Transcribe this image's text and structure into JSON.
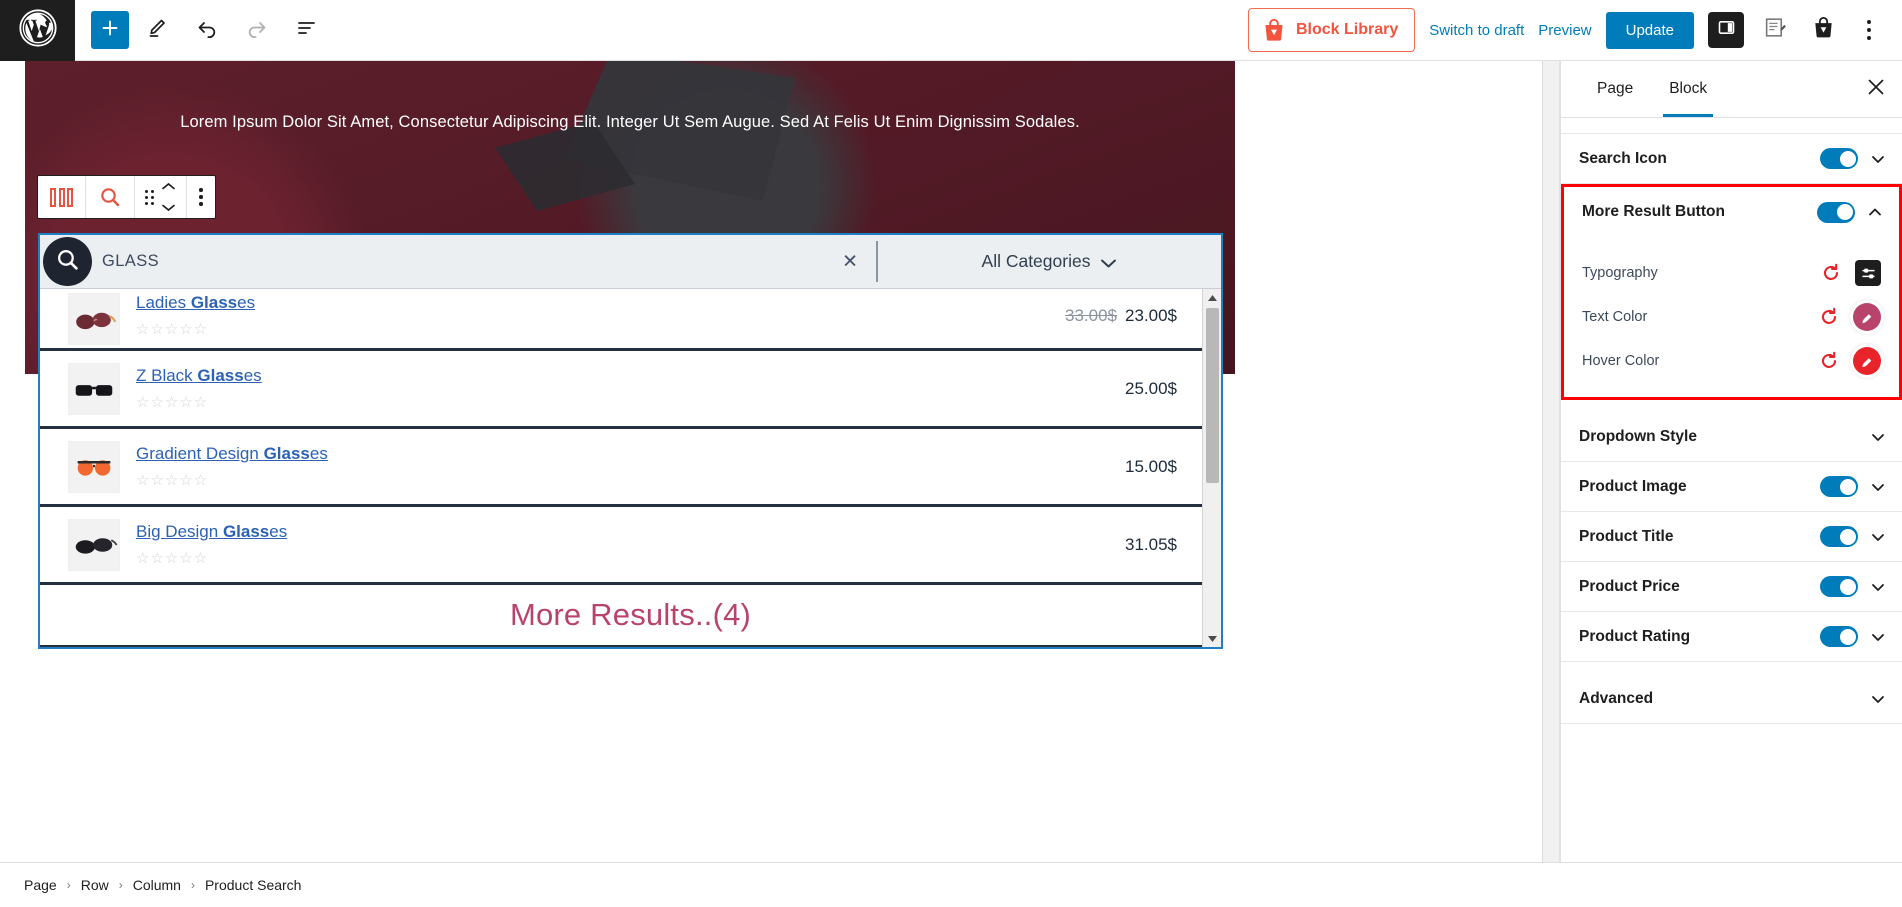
{
  "topbar": {
    "logo_icon": "wordpress-logo-icon",
    "add_block_label": "+",
    "tools": [
      {
        "name": "add-block-button",
        "icon": "plus-icon"
      },
      {
        "name": "edit-tool-button",
        "icon": "pencil-icon"
      },
      {
        "name": "undo-button",
        "icon": "undo-arrow-icon"
      },
      {
        "name": "redo-button",
        "icon": "redo-arrow-icon"
      },
      {
        "name": "document-overview-button",
        "icon": "list-view-icon"
      }
    ],
    "block_library_label": "Block Library",
    "switch_to_draft_label": "Switch to draft",
    "preview_label": "Preview",
    "update_label": "Update",
    "settings_sidebar_icon": "sidebar-panel-icon",
    "edit_post_icon": "document-pencil-icon",
    "shop_bag_icon": "shopping-bag-icon",
    "more_options_icon": "kebab-menu-icon"
  },
  "canvas": {
    "hero_text": "Lorem Ipsum Dolor Sit Amet, Consectetur Adipiscing Elit. Integer Ut Sem Augue. Sed At Felis Ut Enim Dignissim Sodales.",
    "block_toolbar": {
      "columns_icon": "columns-block-icon",
      "search_block_icon": "product-search-icon",
      "drag_icon": "drag-handle-icon",
      "move_up_icon": "chevron-up-icon",
      "move_down_icon": "chevron-down-icon",
      "options_icon": "vertical-kebab-icon"
    },
    "search": {
      "icon": "magnifier-icon",
      "value": "GLASS",
      "clear_icon": "clear-x-icon",
      "category_label": "All Categories",
      "category_chevron": "chevron-down-icon"
    },
    "results": [
      {
        "title_plain": "Ladies ",
        "title_bold": "Glass",
        "title_tail": "es",
        "rating": "☆☆☆☆☆",
        "price_old": "33.00$",
        "price": "23.00$",
        "thumb": "ladies-sunglasses-thumb"
      },
      {
        "title_plain": "Z Black ",
        "title_bold": "Glass",
        "title_tail": "es",
        "rating": "☆☆☆☆☆",
        "price_old": "",
        "price": "25.00$",
        "thumb": "black-sunglasses-thumb"
      },
      {
        "title_plain": "Gradient Design ",
        "title_bold": "Glass",
        "title_tail": "es",
        "rating": "☆☆☆☆☆",
        "price_old": "",
        "price": "15.00$",
        "thumb": "gradient-sunglasses-thumb"
      },
      {
        "title_plain": "Big Design ",
        "title_bold": "Glass",
        "title_tail": "es",
        "rating": "☆☆☆☆☆",
        "price_old": "",
        "price": "31.05$",
        "thumb": "big-design-sunglasses-thumb"
      }
    ],
    "more_results_label": "More Results..(4)"
  },
  "sidebar": {
    "tabs": [
      {
        "label": "Page",
        "active": false
      },
      {
        "label": "Block",
        "active": true
      }
    ],
    "close_icon": "close-x-icon",
    "panels_top": [
      {
        "label": "Search Icon",
        "toggle": true,
        "expanded": false
      }
    ],
    "highlighted_panel": {
      "label": "More Result Button",
      "toggle": true,
      "expanded": true,
      "highlight_color": "#ff0000",
      "rows": [
        {
          "label": "Typography",
          "control": "typography-settings-icon",
          "reset": "reset-icon"
        },
        {
          "label": "Text Color",
          "control": "color-swatch",
          "color": "#b8436b",
          "reset": "reset-icon"
        },
        {
          "label": "Hover Color",
          "control": "color-swatch",
          "color": "#e8232a",
          "reset": "reset-icon"
        }
      ]
    },
    "panels_bottom": [
      {
        "label": "Dropdown Style",
        "toggle": false,
        "expanded": false
      },
      {
        "label": "Product Image",
        "toggle": true,
        "expanded": false
      },
      {
        "label": "Product Title",
        "toggle": true,
        "expanded": false
      },
      {
        "label": "Product Price",
        "toggle": true,
        "expanded": false
      },
      {
        "label": "Product Rating",
        "toggle": true,
        "expanded": false
      },
      {
        "label": "Advanced",
        "toggle": false,
        "expanded": false
      }
    ]
  },
  "breadcrumb": {
    "items": [
      "Page",
      "Row",
      "Column",
      "Product Search"
    ],
    "separator": "›"
  },
  "colors": {
    "accent_blue": "#007cba",
    "brand_orange": "#f2543d",
    "highlight_red": "#ff0000",
    "hero_maroon": "#5d1f2b",
    "more_results_pink": "#b8436b"
  }
}
